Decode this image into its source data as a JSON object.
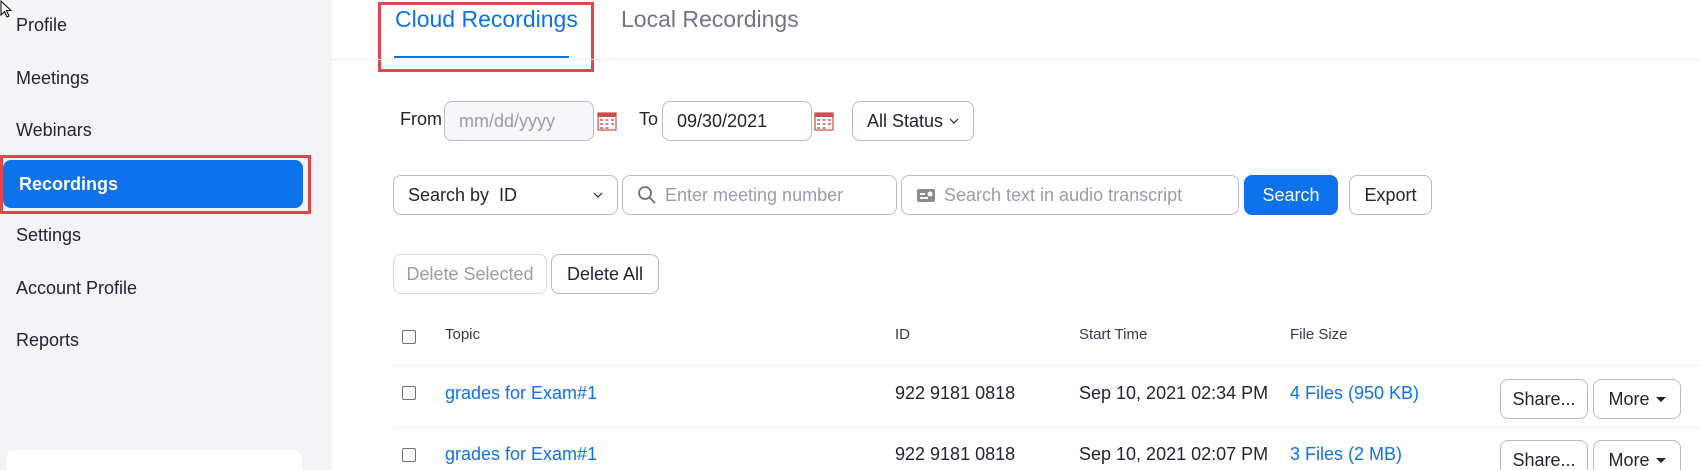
{
  "sidebar": {
    "items": [
      {
        "label": "Profile"
      },
      {
        "label": "Meetings"
      },
      {
        "label": "Webinars"
      },
      {
        "label": "Recordings"
      },
      {
        "label": "Settings"
      },
      {
        "label": "Account Profile"
      },
      {
        "label": "Reports"
      }
    ],
    "active_index": 3
  },
  "tabs": [
    {
      "label": "Cloud Recordings",
      "active": true
    },
    {
      "label": "Local Recordings",
      "active": false
    }
  ],
  "filters": {
    "from_label": "From",
    "from_placeholder": "mm/dd/yyyy",
    "to_label": "To",
    "to_value": "09/30/2021",
    "status_value": "All Status",
    "search_by_value": "Search by  ID",
    "meeting_placeholder": "Enter meeting number",
    "transcript_placeholder": "Search text in audio transcript",
    "search_label": "Search",
    "export_label": "Export"
  },
  "actions": {
    "delete_selected_label": "Delete Selected",
    "delete_all_label": "Delete All"
  },
  "table": {
    "columns": [
      "Topic",
      "ID",
      "Start Time",
      "File Size"
    ],
    "rows": [
      {
        "topic": "grades for Exam#1",
        "id": "922 9181 0818",
        "start": "Sep 10, 2021 02:34 PM",
        "size": "4 Files (950 KB)",
        "share": "Share...",
        "more": "More"
      },
      {
        "topic": "grades for Exam#1",
        "id": "922 9181 0818",
        "start": "Sep 10, 2021 02:07 PM",
        "size": "3 Files (2 MB)",
        "share": "Share...",
        "more": "More"
      }
    ]
  },
  "colors": {
    "accent": "#0e72ed",
    "highlight": "#e0474c",
    "sidebar_bg": "#f4f4f6"
  },
  "icons": [
    "calendar-icon",
    "search-icon",
    "transcript-icon",
    "chevron-down-icon",
    "caret-down-icon",
    "mouse-cursor-icon"
  ]
}
